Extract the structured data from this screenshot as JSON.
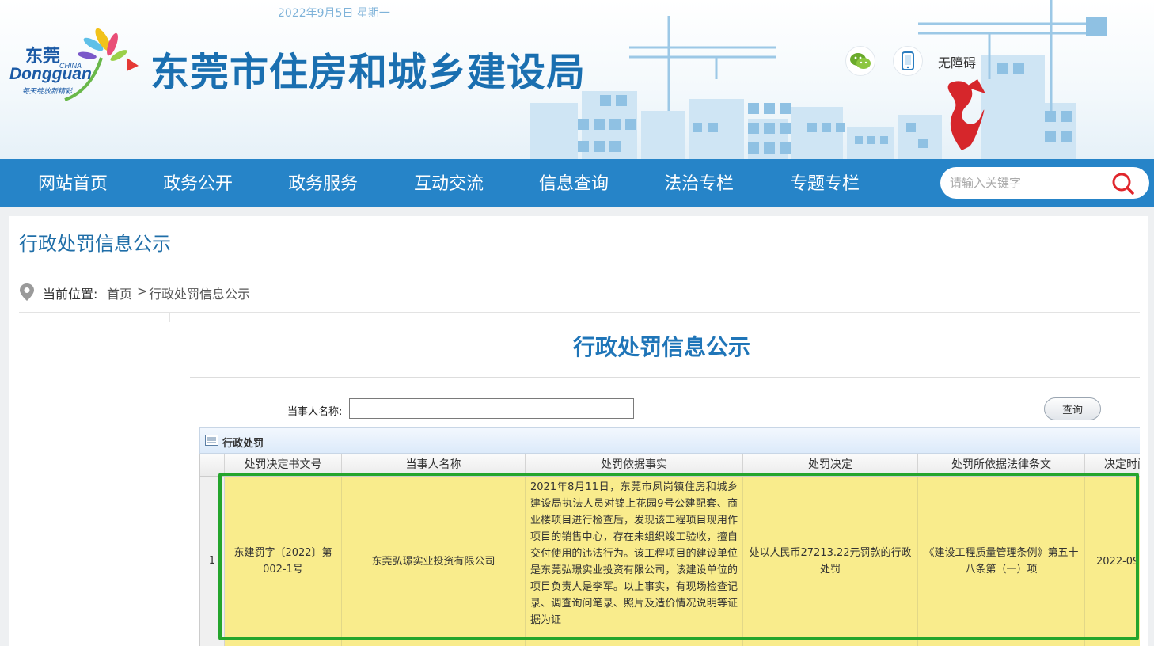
{
  "header": {
    "date": "2022年9月5日 星期一",
    "site_title": "东莞市住房和城乡建设局",
    "logo_text_cn": "东莞",
    "logo_text_en": "Dongguan",
    "logo_text_china": "CHINA",
    "logo_slogan": "每天绽放新精彩",
    "accessible_label": "无障碍",
    "icons": [
      "wechat-icon",
      "mobile-icon"
    ]
  },
  "nav": {
    "items": [
      "网站首页",
      "政务公开",
      "政务服务",
      "互动交流",
      "信息查询",
      "法治专栏",
      "专题专栏"
    ],
    "search_placeholder": "请输入关键字"
  },
  "page": {
    "title": "行政处罚信息公示",
    "breadcrumb_label": "当前位置:",
    "breadcrumb_home": "首页",
    "breadcrumb_sep": ">",
    "breadcrumb_current": "行政处罚信息公示"
  },
  "frame": {
    "title": "行政处罚信息公示",
    "party_label": "当事人名称:",
    "party_value": "",
    "query_label": "查询",
    "grid_caption": "行政处罚",
    "columns": [
      "处罚决定书文号",
      "当事人名称",
      "处罚依据事实",
      "处罚决定",
      "处罚所依据法律条文",
      "决定时间"
    ],
    "rows": [
      {
        "index": "1",
        "doc_no": "东建罚字〔2022〕第002-1号",
        "party": "东莞弘璟实业投资有限公司",
        "facts": "2021年8月11日，东莞市凤岗镇住房和城乡建设局执法人员对锦上花园9号公建配套、商业楼项目进行检查后，发现该工程项目现用作项目的销售中心，存在未组织竣工验收，擅自交付使用的违法行为。该工程项目的建设单位是东莞弘璟实业投资有限公司，该建设单位的项目负责人是李军。以上事实，有现场检查记录、调查询问笔录、照片及造价情况说明等证据为证",
        "decision": "处以人民币27213.22元罚款的行政处罚",
        "law": "《建设工程质量管理条例》第五十八条第（一）项",
        "date": "2022-09"
      }
    ]
  },
  "colors": {
    "nav_bg": "#2684c8",
    "title_blue": "#1a6fb0",
    "row_highlight": "#f9ec8c",
    "selection_border": "#25a52c"
  }
}
